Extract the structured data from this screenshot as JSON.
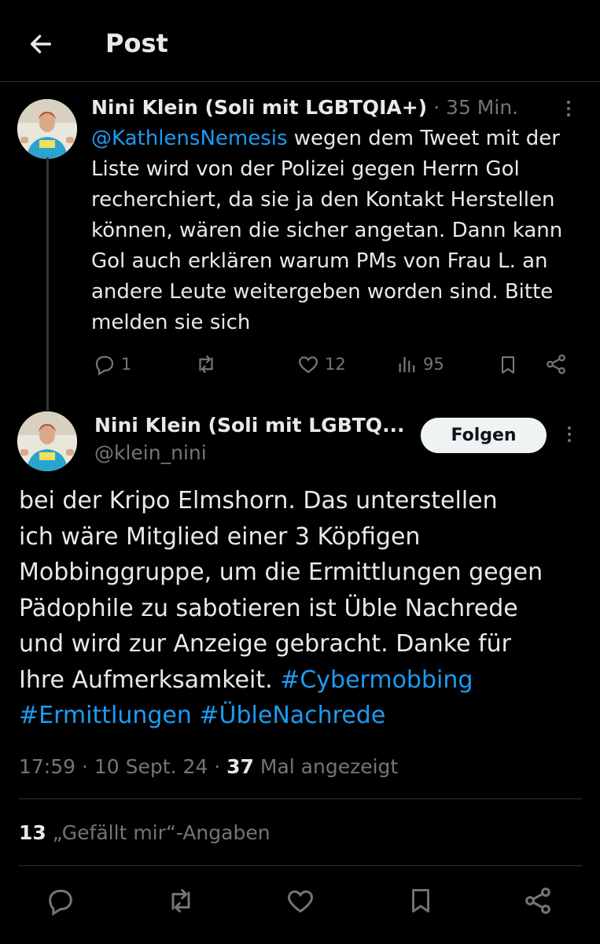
{
  "header": {
    "title": "Post"
  },
  "reply_tweet": {
    "author": "Nini Klein (Soli mit LGBTQIA+)",
    "separator": "·",
    "time": "35 Min.",
    "mention": "@KathlensNemesis",
    "text_lines": [
      "wegen dem Tweet mit der",
      "Liste wird von der Polizei gegen Herrn Gol",
      "recherchiert, da sie ja den Kontakt Herstellen",
      "können, wären die sicher angetan. Dann kann",
      "Gol auch erklären warum PMs von Frau L. an",
      "andere Leute weitergeben worden sind. Bitte",
      "melden sie sich"
    ],
    "actions": {
      "replies": "1",
      "reposts": "",
      "likes": "12",
      "views": "95"
    }
  },
  "main_tweet": {
    "author": "Nini Klein (Soli mit LGBTQ...",
    "handle": "@klein_nini",
    "follow_label": "Folgen",
    "text_lines": [
      "bei der Kripo Elmshorn. Das unterstellen",
      "ich wäre Mitglied einer 3 Köpfigen",
      "Mobbinggruppe, um die Ermittlungen gegen",
      "Pädophile zu sabotieren ist Üble Nachrede",
      "und wird zur Anzeige gebracht. Danke für",
      "Ihre Aufmerksamkeit."
    ],
    "hashtags": [
      "#Cybermobbing",
      "#Ermittlungen",
      "#ÜbleNachrede"
    ],
    "timestamp": "17:59 · 10 Sept. 24 ·",
    "view_count": "37",
    "view_label": "Mal angezeigt",
    "likes_count": "13",
    "likes_label": "„Gefällt mir“-Angaben"
  },
  "colors": {
    "background": "#000000",
    "text": "#e7e9ea",
    "muted": "#71767b",
    "link": "#1d9bf0",
    "divider": "#2f3336"
  },
  "icons": [
    "arrow-left-icon",
    "more-icon",
    "reply-icon",
    "repost-icon",
    "like-icon",
    "views-icon",
    "bookmark-icon",
    "share-icon"
  ]
}
